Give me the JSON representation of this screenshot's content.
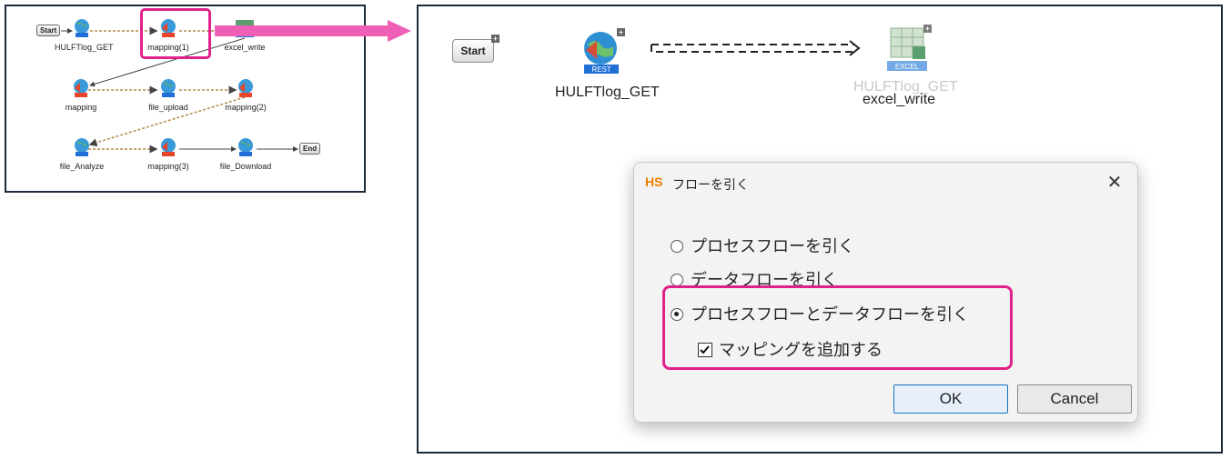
{
  "overview": {
    "start_label": "Start",
    "end_label": "End",
    "nodes": [
      {
        "label": "HULFTlog_GET",
        "kind": "REST"
      },
      {
        "label": "mapping(1)",
        "kind": "MAPPER"
      },
      {
        "label": "excel_write",
        "kind": "EXCEL"
      },
      {
        "label": "mapping",
        "kind": "MAPPER"
      },
      {
        "label": "file_upload",
        "kind": "REST"
      },
      {
        "label": "mapping(2)",
        "kind": "MAPPER"
      },
      {
        "label": "file_Analyze",
        "kind": "REST"
      },
      {
        "label": "mapping(3)",
        "kind": "MAPPER"
      },
      {
        "label": "file_Download",
        "kind": "REST"
      }
    ]
  },
  "canvas": {
    "start_label": "Start",
    "node1_label": "HULFTlog_GET",
    "node1_badge": "REST",
    "node2_label": "excel_write",
    "node2_badge": "EXCEL",
    "ghost_label": "HULFTlog_GET"
  },
  "dialog": {
    "logo": "HS",
    "title": "フローを引く",
    "close": "✕",
    "options": [
      {
        "label": "プロセスフローを引く",
        "selected": false
      },
      {
        "label": "データフローを引く",
        "selected": false
      },
      {
        "label": "プロセスフローとデータフローを引く",
        "selected": true
      }
    ],
    "checkbox_label": "マッピングを追加する",
    "checkbox_checked": true,
    "ok_label": "OK",
    "cancel_label": "Cancel"
  },
  "colors": {
    "highlight": "#e0218a",
    "rest_badge": "#1f6fd6",
    "mapper_badge": "#e8442a",
    "dialog_logo": "#f07c00",
    "ok_border": "#1a73c4"
  }
}
